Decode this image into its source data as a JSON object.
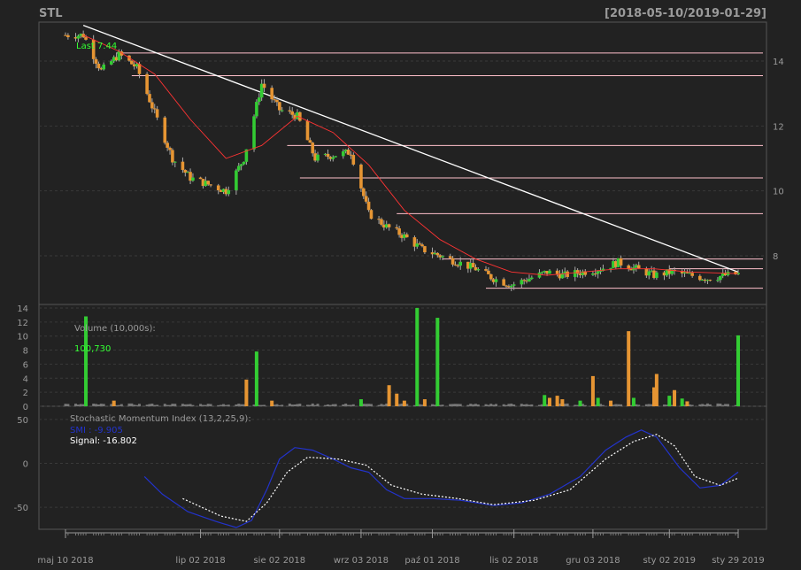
{
  "chart_data": [
    {
      "type": "candlestick",
      "title": "STL",
      "date_range": "[2018-05-10/2019-01-29]",
      "last_label": "Last 7.44",
      "yticks": [
        8,
        10,
        12,
        14
      ],
      "ylim": [
        6.5,
        15.2
      ],
      "x_ticklabels": [
        {
          "label": "maj 10 2018",
          "date": "2018-05-10"
        },
        {
          "label": "lip 02 2018",
          "date": "2018-07-02"
        },
        {
          "label": "sie 02 2018",
          "date": "2018-08-02"
        },
        {
          "label": "wrz 03 2018",
          "date": "2018-09-03"
        },
        {
          "label": "paź 01 2018",
          "date": "2018-10-01"
        },
        {
          "label": "lis 02 2018",
          "date": "2018-11-02"
        },
        {
          "label": "gru 03 2018",
          "date": "2018-12-03"
        },
        {
          "label": "sty 02 2019",
          "date": "2019-01-02"
        },
        {
          "label": "sty 29 2019",
          "date": "2019-01-29"
        }
      ],
      "trend_line": {
        "from": {
          "date": "2018-05-17",
          "value": 15.1
        },
        "to": {
          "date": "2019-01-29",
          "value": 7.5
        }
      },
      "horizontal_levels": [
        {
          "value": 14.25,
          "from_date": "2018-05-30"
        },
        {
          "value": 13.55,
          "from_date": "2018-06-05"
        },
        {
          "value": 11.4,
          "from_date": "2018-08-05"
        },
        {
          "value": 10.4,
          "from_date": "2018-08-10"
        },
        {
          "value": 9.3,
          "from_date": "2018-09-17"
        },
        {
          "value": 7.9,
          "from_date": "2018-10-05"
        },
        {
          "value": 7.6,
          "from_date": "2019-01-02"
        },
        {
          "value": 7.0,
          "from_date": "2018-10-22"
        }
      ],
      "close_path": [
        {
          "date": "2018-05-10",
          "value": 14.8
        },
        {
          "date": "2018-05-17",
          "value": 14.8
        },
        {
          "date": "2018-05-24",
          "value": 13.7
        },
        {
          "date": "2018-05-31",
          "value": 14.2
        },
        {
          "date": "2018-06-07",
          "value": 13.8
        },
        {
          "date": "2018-06-14",
          "value": 12.4
        },
        {
          "date": "2018-06-21",
          "value": 11.0
        },
        {
          "date": "2018-06-28",
          "value": 10.4
        },
        {
          "date": "2018-07-05",
          "value": 10.2
        },
        {
          "date": "2018-07-12",
          "value": 10.0
        },
        {
          "date": "2018-07-19",
          "value": 11.0
        },
        {
          "date": "2018-07-26",
          "value": 13.3
        },
        {
          "date": "2018-08-02",
          "value": 12.5
        },
        {
          "date": "2018-08-09",
          "value": 12.3
        },
        {
          "date": "2018-08-16",
          "value": 11.0
        },
        {
          "date": "2018-08-23",
          "value": 11.1
        },
        {
          "date": "2018-08-30",
          "value": 11.2
        },
        {
          "date": "2018-09-06",
          "value": 9.3
        },
        {
          "date": "2018-09-13",
          "value": 8.9
        },
        {
          "date": "2018-09-20",
          "value": 8.6
        },
        {
          "date": "2018-09-27",
          "value": 8.2
        },
        {
          "date": "2018-10-04",
          "value": 8.0
        },
        {
          "date": "2018-10-11",
          "value": 7.8
        },
        {
          "date": "2018-10-18",
          "value": 7.6
        },
        {
          "date": "2018-10-25",
          "value": 7.3
        },
        {
          "date": "2018-11-01",
          "value": 7.1
        },
        {
          "date": "2018-11-08",
          "value": 7.3
        },
        {
          "date": "2018-11-15",
          "value": 7.5
        },
        {
          "date": "2018-11-22",
          "value": 7.4
        },
        {
          "date": "2018-11-29",
          "value": 7.5
        },
        {
          "date": "2018-12-06",
          "value": 7.6
        },
        {
          "date": "2018-12-13",
          "value": 7.8
        },
        {
          "date": "2018-12-20",
          "value": 7.6
        },
        {
          "date": "2018-12-27",
          "value": 7.4
        },
        {
          "date": "2019-01-03",
          "value": 7.5
        },
        {
          "date": "2019-01-10",
          "value": 7.4
        },
        {
          "date": "2019-01-17",
          "value": 7.3
        },
        {
          "date": "2019-01-24",
          "value": 7.4
        },
        {
          "date": "2019-01-29",
          "value": 7.44
        }
      ],
      "ma_path": [
        {
          "date": "2018-05-17",
          "value": 14.8
        },
        {
          "date": "2018-05-31",
          "value": 14.3
        },
        {
          "date": "2018-06-14",
          "value": 13.6
        },
        {
          "date": "2018-06-28",
          "value": 12.2
        },
        {
          "date": "2018-07-12",
          "value": 11.0
        },
        {
          "date": "2018-07-26",
          "value": 11.4
        },
        {
          "date": "2018-08-09",
          "value": 12.3
        },
        {
          "date": "2018-08-23",
          "value": 11.8
        },
        {
          "date": "2018-09-06",
          "value": 10.8
        },
        {
          "date": "2018-09-20",
          "value": 9.4
        },
        {
          "date": "2018-10-04",
          "value": 8.5
        },
        {
          "date": "2018-10-18",
          "value": 7.9
        },
        {
          "date": "2018-11-01",
          "value": 7.5
        },
        {
          "date": "2018-11-15",
          "value": 7.4
        },
        {
          "date": "2018-11-29",
          "value": 7.5
        },
        {
          "date": "2018-12-13",
          "value": 7.6
        },
        {
          "date": "2018-12-27",
          "value": 7.6
        },
        {
          "date": "2019-01-10",
          "value": 7.5
        },
        {
          "date": "2019-01-29",
          "value": 7.45
        }
      ],
      "colors": {
        "up": "#33cc33",
        "down": "#e69533",
        "trend": "#ffffff",
        "levels": "#ffc0cb",
        "ma": "#ff3333",
        "title": "#9a9a9a",
        "last": "#33ff33"
      }
    },
    {
      "type": "bar",
      "title": "Volume (10,000s):",
      "last_value": "100,730",
      "yticks": [
        0,
        2,
        4,
        6,
        8,
        10,
        12,
        14
      ],
      "ylim": [
        0,
        14.5
      ],
      "bars": [
        {
          "date": "2018-05-18",
          "value": 12.8,
          "dir": "up"
        },
        {
          "date": "2018-05-29",
          "value": 0.8,
          "dir": "down"
        },
        {
          "date": "2018-07-20",
          "value": 3.8,
          "dir": "down"
        },
        {
          "date": "2018-07-24",
          "value": 7.8,
          "dir": "up"
        },
        {
          "date": "2018-07-30",
          "value": 0.8,
          "dir": "down"
        },
        {
          "date": "2018-09-03",
          "value": 1.0,
          "dir": "up"
        },
        {
          "date": "2018-09-14",
          "value": 3.0,
          "dir": "down"
        },
        {
          "date": "2018-09-17",
          "value": 1.8,
          "dir": "down"
        },
        {
          "date": "2018-09-20",
          "value": 0.8,
          "dir": "down"
        },
        {
          "date": "2018-09-25",
          "value": 14.0,
          "dir": "up"
        },
        {
          "date": "2018-09-28",
          "value": 1.0,
          "dir": "down"
        },
        {
          "date": "2018-10-03",
          "value": 12.6,
          "dir": "up"
        },
        {
          "date": "2018-11-14",
          "value": 1.6,
          "dir": "up"
        },
        {
          "date": "2018-11-16",
          "value": 1.2,
          "dir": "down"
        },
        {
          "date": "2018-11-19",
          "value": 1.5,
          "dir": "down"
        },
        {
          "date": "2018-11-21",
          "value": 1.0,
          "dir": "down"
        },
        {
          "date": "2018-11-28",
          "value": 0.8,
          "dir": "up"
        },
        {
          "date": "2018-12-03",
          "value": 4.3,
          "dir": "down"
        },
        {
          "date": "2018-12-05",
          "value": 1.2,
          "dir": "up"
        },
        {
          "date": "2018-12-10",
          "value": 0.8,
          "dir": "down"
        },
        {
          "date": "2018-12-17",
          "value": 10.7,
          "dir": "down"
        },
        {
          "date": "2018-12-19",
          "value": 1.2,
          "dir": "up"
        },
        {
          "date": "2018-12-27",
          "value": 2.7,
          "dir": "down"
        },
        {
          "date": "2018-12-28",
          "value": 4.6,
          "dir": "down"
        },
        {
          "date": "2019-01-02",
          "value": 1.5,
          "dir": "up"
        },
        {
          "date": "2019-01-04",
          "value": 2.3,
          "dir": "down"
        },
        {
          "date": "2019-01-07",
          "value": 1.1,
          "dir": "up"
        },
        {
          "date": "2019-01-09",
          "value": 0.7,
          "dir": "down"
        },
        {
          "date": "2019-01-29",
          "value": 10.1,
          "dir": "up"
        }
      ]
    },
    {
      "type": "line",
      "title": "Stochastic Momentum Index (13,2,25,9):",
      "legend": [
        {
          "label": "SMI : -9.905",
          "color": "#2233cc"
        },
        {
          "label": "Signal: -16.802",
          "color": "#ffffff"
        }
      ],
      "yticks": [
        -50,
        0,
        50
      ],
      "ylim": [
        -75,
        65
      ],
      "series": [
        {
          "name": "SMI",
          "values": [
            {
              "date": "2018-06-10",
              "value": -15
            },
            {
              "date": "2018-06-17",
              "value": -35
            },
            {
              "date": "2018-06-27",
              "value": -55
            },
            {
              "date": "2018-07-08",
              "value": -66
            },
            {
              "date": "2018-07-16",
              "value": -73
            },
            {
              "date": "2018-07-22",
              "value": -65
            },
            {
              "date": "2018-07-28",
              "value": -30
            },
            {
              "date": "2018-08-02",
              "value": 5
            },
            {
              "date": "2018-08-08",
              "value": 18
            },
            {
              "date": "2018-08-15",
              "value": 15
            },
            {
              "date": "2018-08-23",
              "value": 5
            },
            {
              "date": "2018-08-30",
              "value": -5
            },
            {
              "date": "2018-09-06",
              "value": -10
            },
            {
              "date": "2018-09-13",
              "value": -30
            },
            {
              "date": "2018-09-20",
              "value": -40
            },
            {
              "date": "2018-10-01",
              "value": -40
            },
            {
              "date": "2018-10-12",
              "value": -42
            },
            {
              "date": "2018-10-25",
              "value": -48
            },
            {
              "date": "2018-11-05",
              "value": -45
            },
            {
              "date": "2018-11-16",
              "value": -35
            },
            {
              "date": "2018-11-28",
              "value": -15
            },
            {
              "date": "2018-12-08",
              "value": 15
            },
            {
              "date": "2018-12-16",
              "value": 30
            },
            {
              "date": "2018-12-22",
              "value": 38
            },
            {
              "date": "2018-12-28",
              "value": 30
            },
            {
              "date": "2019-01-06",
              "value": -5
            },
            {
              "date": "2019-01-14",
              "value": -28
            },
            {
              "date": "2019-01-22",
              "value": -25
            },
            {
              "date": "2019-01-29",
              "value": -9.905
            }
          ]
        },
        {
          "name": "Signal",
          "values": [
            {
              "date": "2018-06-25",
              "value": -40
            },
            {
              "date": "2018-07-10",
              "value": -60
            },
            {
              "date": "2018-07-20",
              "value": -66
            },
            {
              "date": "2018-07-28",
              "value": -45
            },
            {
              "date": "2018-08-05",
              "value": -10
            },
            {
              "date": "2018-08-13",
              "value": 7
            },
            {
              "date": "2018-08-25",
              "value": 5
            },
            {
              "date": "2018-09-05",
              "value": -2
            },
            {
              "date": "2018-09-15",
              "value": -25
            },
            {
              "date": "2018-09-27",
              "value": -35
            },
            {
              "date": "2018-10-11",
              "value": -40
            },
            {
              "date": "2018-10-25",
              "value": -47
            },
            {
              "date": "2018-11-10",
              "value": -42
            },
            {
              "date": "2018-11-24",
              "value": -30
            },
            {
              "date": "2018-12-08",
              "value": 5
            },
            {
              "date": "2018-12-19",
              "value": 25
            },
            {
              "date": "2018-12-28",
              "value": 33
            },
            {
              "date": "2019-01-04",
              "value": 20
            },
            {
              "date": "2019-01-12",
              "value": -15
            },
            {
              "date": "2019-01-22",
              "value": -25
            },
            {
              "date": "2019-01-29",
              "value": -16.802
            }
          ]
        }
      ]
    }
  ]
}
